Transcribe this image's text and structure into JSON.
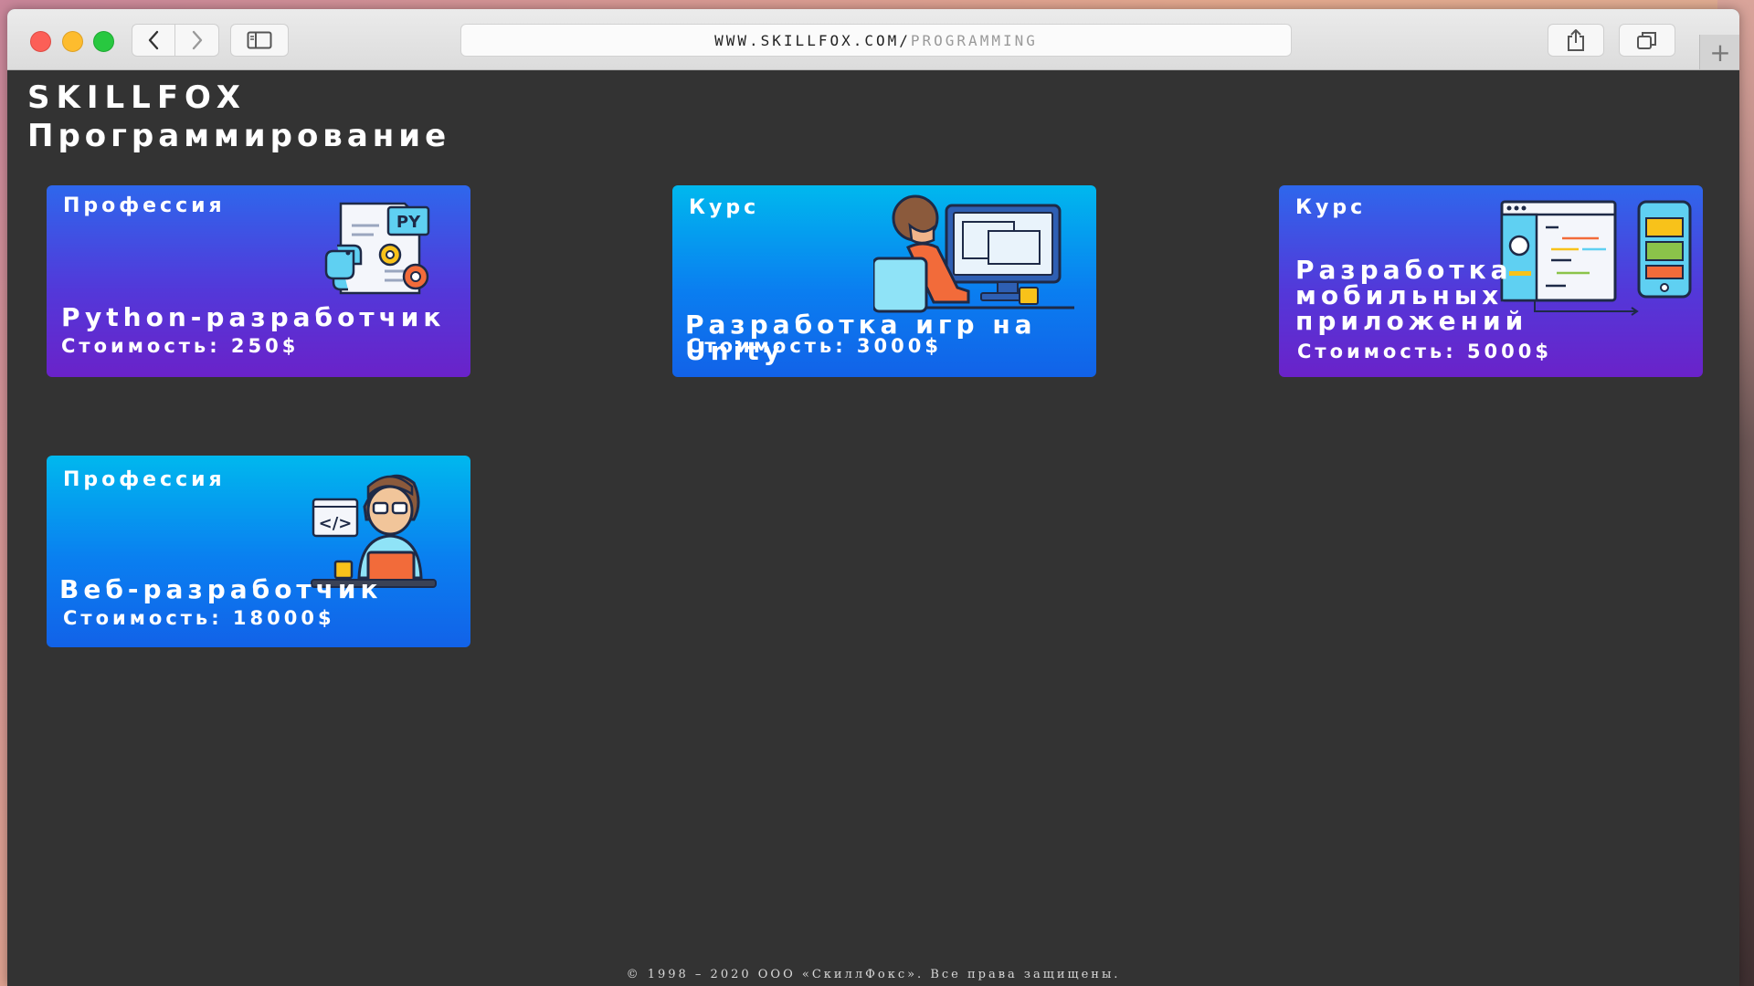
{
  "browser": {
    "url_host": "WWW.SKILLFOX.COM/",
    "url_path": "PROGRAMMING",
    "new_tab_symbol": "+"
  },
  "page": {
    "brand": "SKILLFOX",
    "title": "Программирование",
    "footer": "© 1998 – 2020 ООО «СкиллФокс». Все права защищены."
  },
  "cards": [
    {
      "type": "Профессия",
      "name_lines": [
        "Python-разработчик"
      ],
      "price": "Стоимость: 250$",
      "illustration": "python-icon",
      "py_label": "PY"
    },
    {
      "type": "Курс",
      "name_lines": [
        "Разработка игр на Unity"
      ],
      "price": "Стоимость: 3000$",
      "illustration": "developer-at-computer-icon"
    },
    {
      "type": "Курс",
      "name_lines": [
        "Разработка",
        "мобильных",
        "приложений"
      ],
      "price": "Стоимость: 5000$",
      "illustration": "mobile-app-icon"
    },
    {
      "type": "Профессия",
      "name_lines": [
        "Веб-разработчик"
      ],
      "price": "Стоимость: 18000$",
      "illustration": "web-developer-icon",
      "code_label": "</>"
    }
  ],
  "colors": {
    "page_bg": "#333333",
    "card_purple_top": "#2e67ec",
    "card_purple_bottom": "#6a22c9",
    "card_blue_top": "#00b8ee",
    "card_blue_bottom": "#1262e8"
  }
}
